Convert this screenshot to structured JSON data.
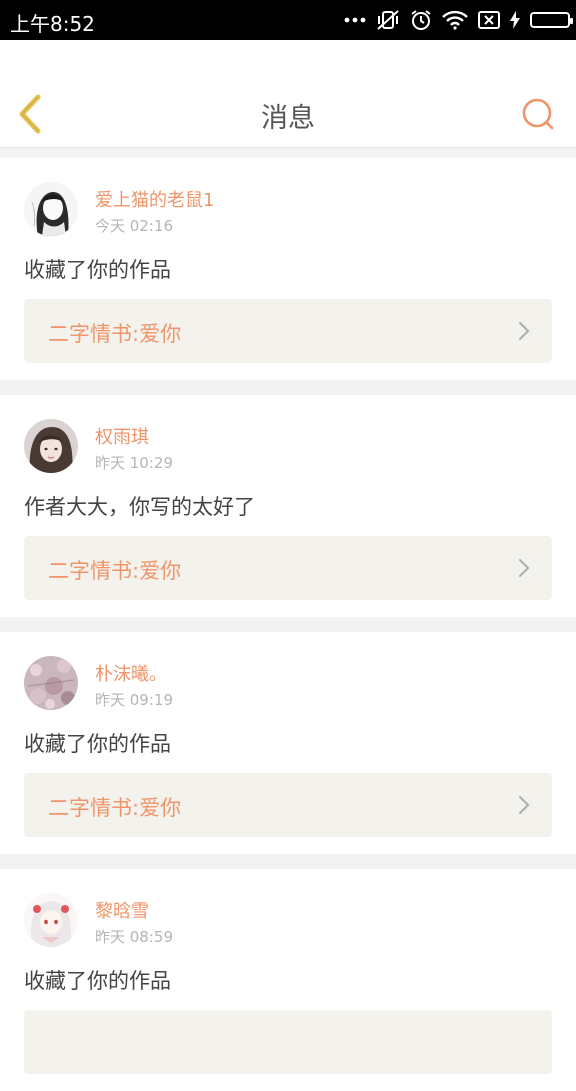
{
  "status_bar": {
    "time": "上午8:52",
    "icons": [
      "more-dots-icon",
      "vibrate-off-icon",
      "alarm-icon",
      "wifi-icon",
      "sim-off-icon",
      "charging-icon",
      "battery-icon"
    ],
    "battery_color": "#35d03a"
  },
  "header": {
    "title": "消息",
    "back_icon": "chevron-left-icon",
    "search_icon": "search-icon",
    "accent_back": "#e7c24e",
    "accent_search": "#f0956a"
  },
  "messages": [
    {
      "username": "爱上猫的老鼠1",
      "time": "今天 02:16",
      "content": "收藏了你的作品",
      "work": "二字情书:爱你"
    },
    {
      "username": "权雨琪",
      "time": "昨天 10:29",
      "content": "作者大大，你写的太好了",
      "work": "二字情书:爱你"
    },
    {
      "username": "朴沫曦。",
      "time": "昨天 09:19",
      "content": "收藏了你的作品",
      "work": "二字情书:爱你"
    },
    {
      "username": "黎晗雪",
      "time": "昨天 08:59",
      "content": "收藏了你的作品",
      "work": ""
    }
  ]
}
